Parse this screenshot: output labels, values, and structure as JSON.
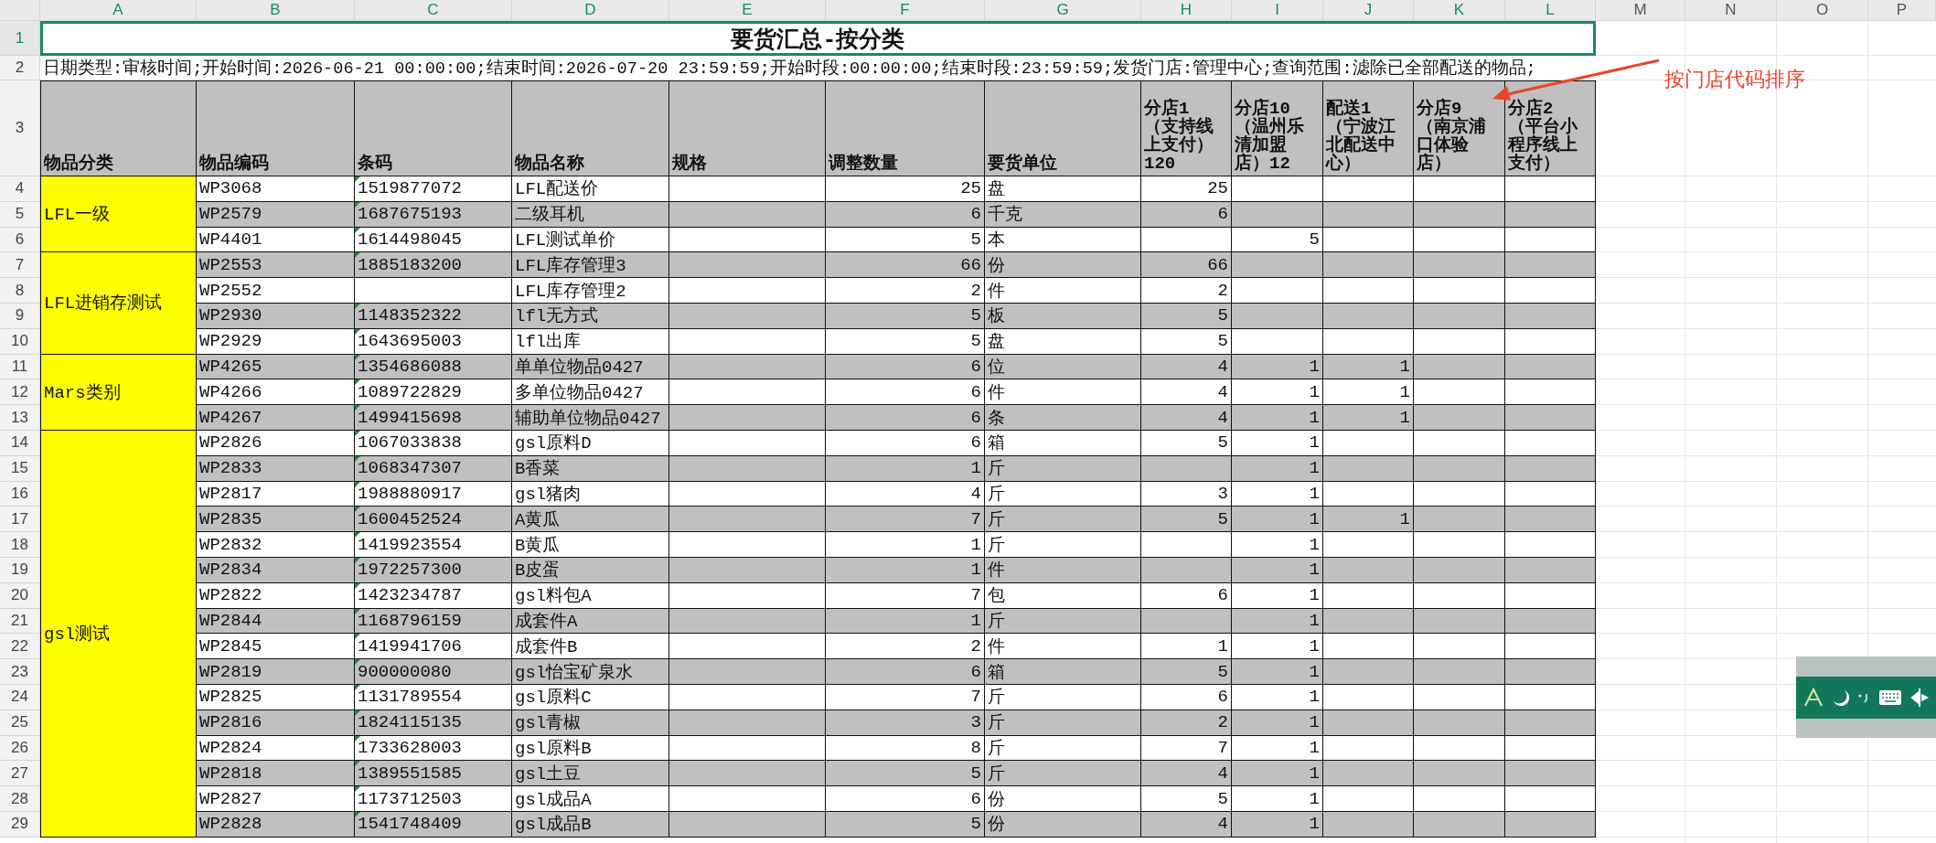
{
  "column_headers": [
    {
      "label": "A",
      "selected": true
    },
    {
      "label": "B",
      "selected": true
    },
    {
      "label": "C",
      "selected": true
    },
    {
      "label": "D",
      "selected": true
    },
    {
      "label": "E",
      "selected": true
    },
    {
      "label": "F",
      "selected": true
    },
    {
      "label": "G",
      "selected": true
    },
    {
      "label": "H",
      "selected": true
    },
    {
      "label": "I",
      "selected": true
    },
    {
      "label": "J",
      "selected": true
    },
    {
      "label": "K",
      "selected": true
    },
    {
      "label": "L",
      "selected": true
    },
    {
      "label": "M",
      "selected": false
    },
    {
      "label": "N",
      "selected": false
    },
    {
      "label": "O",
      "selected": false
    },
    {
      "label": "P",
      "selected": false
    }
  ],
  "row_numbers": [
    {
      "label": "1",
      "selected": true
    },
    {
      "label": "2",
      "selected": false
    },
    {
      "label": "3",
      "selected": false
    },
    {
      "label": "4",
      "selected": false
    },
    {
      "label": "5",
      "selected": false
    },
    {
      "label": "6",
      "selected": false
    },
    {
      "label": "7",
      "selected": false
    },
    {
      "label": "8",
      "selected": false
    },
    {
      "label": "9",
      "selected": false
    },
    {
      "label": "10",
      "selected": false
    },
    {
      "label": "11",
      "selected": false
    },
    {
      "label": "12",
      "selected": false
    },
    {
      "label": "13",
      "selected": false
    },
    {
      "label": "14",
      "selected": false
    },
    {
      "label": "15",
      "selected": false
    },
    {
      "label": "16",
      "selected": false
    },
    {
      "label": "17",
      "selected": false
    },
    {
      "label": "18",
      "selected": false
    },
    {
      "label": "19",
      "selected": false
    },
    {
      "label": "20",
      "selected": false
    },
    {
      "label": "21",
      "selected": false
    },
    {
      "label": "22",
      "selected": false
    },
    {
      "label": "23",
      "selected": false
    },
    {
      "label": "24",
      "selected": false
    },
    {
      "label": "25",
      "selected": false
    },
    {
      "label": "26",
      "selected": false
    },
    {
      "label": "27",
      "selected": false
    },
    {
      "label": "28",
      "selected": false
    },
    {
      "label": "29",
      "selected": false
    }
  ],
  "title": {
    "text": "要货汇总-按分类",
    "selected": true
  },
  "filter_text": "日期类型:审核时间;开始时间:2026-06-21 00:00:00;结束时间:2026-07-20 23:59:59;开始时段:00:00:00;结束时段:23:59:59;发货门店:管理中心;查询范围:滤除已全部配送的物品;",
  "headers": [
    "物品分类",
    "物品编码",
    "条码",
    "物品名称",
    "规格",
    "调整数量",
    "要货单位",
    "分店1（支持线上支付）120",
    "分店10（温州乐清加盟店）12",
    "配送1（宁波江北配送中心）",
    "分店9（南京浦口体验店）",
    "分店2（平台小程序线上支付）"
  ],
  "categories": [
    {
      "name": "LFL一级",
      "items": [
        {
          "code": "WP3068",
          "barcode": "1519877072",
          "name": "LFL配送价",
          "qty": "25",
          "unit": "盘",
          "stores": {
            "s1": "25"
          }
        },
        {
          "code": "WP2579",
          "barcode": "1687675193",
          "name": "二级耳机",
          "qty": "6",
          "unit": "千克",
          "stores": {
            "s1": "6"
          }
        },
        {
          "code": "WP4401",
          "barcode": "1614498045",
          "name": "LFL测试单价",
          "qty": "5",
          "unit": "本",
          "stores": {
            "s2": "5"
          }
        }
      ]
    },
    {
      "name": "LFL进销存测试",
      "items": [
        {
          "code": "WP2553",
          "barcode": "1885183200",
          "name": "LFL库存管理3",
          "qty": "66",
          "unit": "份",
          "stores": {
            "s1": "66"
          }
        },
        {
          "code": "WP2552",
          "name": "LFL库存管理2",
          "qty": "2",
          "unit": "件",
          "stores": {
            "s1": "2"
          }
        },
        {
          "code": "WP2930",
          "barcode": "1148352322",
          "name": "lfl无方式",
          "qty": "5",
          "unit": "板",
          "stores": {
            "s1": "5"
          }
        },
        {
          "code": "WP2929",
          "barcode": "1643695003",
          "name": "lfl出库",
          "qty": "5",
          "unit": "盘",
          "stores": {
            "s1": "5"
          }
        }
      ]
    },
    {
      "name": "Mars类别",
      "items": [
        {
          "code": "WP4265",
          "barcode": "1354686088",
          "name": "单单位物品0427",
          "qty": "6",
          "unit": "位",
          "stores": {
            "s1": "4",
            "s2": "1",
            "s3": "1"
          }
        },
        {
          "code": "WP4266",
          "barcode": "1089722829",
          "name": "多单位物品0427",
          "qty": "6",
          "unit": "件",
          "stores": {
            "s1": "4",
            "s2": "1",
            "s3": "1"
          }
        },
        {
          "code": "WP4267",
          "barcode": "1499415698",
          "name": "辅助单位物品0427",
          "qty": "6",
          "unit": "条",
          "stores": {
            "s1": "4",
            "s2": "1",
            "s3": "1"
          }
        }
      ]
    },
    {
      "name": "gsl测试",
      "items": [
        {
          "code": "WP2826",
          "barcode": "1067033838",
          "name": "gsl原料D",
          "qty": "6",
          "unit": "箱",
          "stores": {
            "s1": "5",
            "s2": "1"
          }
        },
        {
          "code": "WP2833",
          "barcode": "1068347307",
          "name": "B香菜",
          "qty": "1",
          "unit": "斤",
          "stores": {
            "s2": "1"
          }
        },
        {
          "code": "WP2817",
          "barcode": "1988880917",
          "name": "gsl猪肉",
          "qty": "4",
          "unit": "斤",
          "stores": {
            "s1": "3",
            "s2": "1"
          }
        },
        {
          "code": "WP2835",
          "barcode": "1600452524",
          "name": "A黄瓜",
          "qty": "7",
          "unit": "斤",
          "stores": {
            "s1": "5",
            "s2": "1",
            "s3": "1"
          }
        },
        {
          "code": "WP2832",
          "barcode": "1419923554",
          "name": "B黄瓜",
          "qty": "1",
          "unit": "斤",
          "stores": {
            "s2": "1"
          }
        },
        {
          "code": "WP2834",
          "barcode": "1972257300",
          "name": "B皮蛋",
          "qty": "1",
          "unit": "件",
          "stores": {
            "s2": "1"
          }
        },
        {
          "code": "WP2822",
          "barcode": "1423234787",
          "name": "gsl料包A",
          "qty": "7",
          "unit": "包",
          "stores": {
            "s1": "6",
            "s2": "1"
          }
        },
        {
          "code": "WP2844",
          "barcode": "1168796159",
          "name": "成套件A",
          "qty": "1",
          "unit": "斤",
          "stores": {
            "s2": "1"
          }
        },
        {
          "code": "WP2845",
          "barcode": "1419941706",
          "name": "成套件B",
          "qty": "2",
          "unit": "件",
          "stores": {
            "s1": "1",
            "s2": "1"
          }
        },
        {
          "code": "WP2819",
          "barcode": "900000080",
          "name": "gsl怡宝矿泉水",
          "qty": "6",
          "unit": "箱",
          "stores": {
            "s1": "5",
            "s2": "1"
          }
        },
        {
          "code": "WP2825",
          "barcode": "1131789554",
          "name": "gsl原料C",
          "qty": "7",
          "unit": "斤",
          "stores": {
            "s1": "6",
            "s2": "1"
          }
        },
        {
          "code": "WP2816",
          "barcode": "1824115135",
          "name": "gsl青椒",
          "qty": "3",
          "unit": "斤",
          "stores": {
            "s1": "2",
            "s2": "1"
          }
        },
        {
          "code": "WP2824",
          "barcode": "1733628003",
          "name": "gsl原料B",
          "qty": "8",
          "unit": "斤",
          "stores": {
            "s1": "7",
            "s2": "1"
          }
        },
        {
          "code": "WP2818",
          "barcode": "1389551585",
          "name": "gsl土豆",
          "qty": "5",
          "unit": "斤",
          "stores": {
            "s1": "4",
            "s2": "1"
          }
        },
        {
          "code": "WP2827",
          "barcode": "1173712503",
          "name": "gsl成品A",
          "qty": "6",
          "unit": "份",
          "stores": {
            "s1": "5",
            "s2": "1"
          }
        },
        {
          "code": "WP2828",
          "barcode": "1541748409",
          "name": "gsl成品B",
          "qty": "5",
          "unit": "份",
          "stores": {
            "s1": "4",
            "s2": "1"
          }
        }
      ]
    }
  ],
  "annotation": "按门店代码排序"
}
